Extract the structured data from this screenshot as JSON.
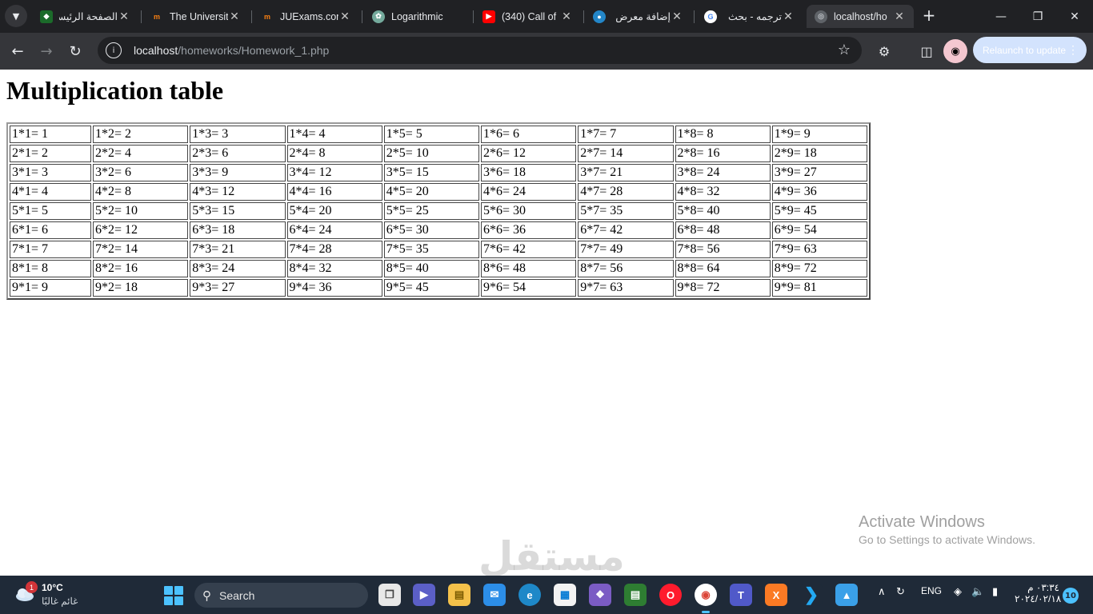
{
  "browser": {
    "tabs": [
      {
        "title": "الصفحة الرئيسية",
        "icon": "ju-logo-icon",
        "active": false
      },
      {
        "title": "The University",
        "icon": "moodle-icon",
        "active": false
      },
      {
        "title": "JUExams.com",
        "icon": "moodle-icon",
        "active": false
      },
      {
        "title": "Logarithmic",
        "icon": "chatgpt-icon",
        "active": false
      },
      {
        "title": "(340) Call of",
        "icon": "youtube-icon",
        "active": false
      },
      {
        "title": "إضافة معرض",
        "icon": "mostaql-icon",
        "active": false
      },
      {
        "title": "ترجمه - بحث",
        "icon": "google-icon",
        "active": false
      },
      {
        "title": "localhost/ho",
        "icon": "globe-icon",
        "active": true
      }
    ],
    "url_host": "localhost",
    "url_path": "/homeworks/Homework_1.php",
    "relaunch_label": "Relaunch to update"
  },
  "page": {
    "title": "Multiplication table",
    "rows": [
      [
        "1*1= 1",
        "1*2= 2",
        "1*3= 3",
        "1*4= 4",
        "1*5= 5",
        "1*6= 6",
        "1*7= 7",
        "1*8= 8",
        "1*9= 9"
      ],
      [
        "2*1= 2",
        "2*2= 4",
        "2*3= 6",
        "2*4= 8",
        "2*5= 10",
        "2*6= 12",
        "2*7= 14",
        "2*8= 16",
        "2*9= 18"
      ],
      [
        "3*1= 3",
        "3*2= 6",
        "3*3= 9",
        "3*4= 12",
        "3*5= 15",
        "3*6= 18",
        "3*7= 21",
        "3*8= 24",
        "3*9= 27"
      ],
      [
        "4*1= 4",
        "4*2= 8",
        "4*3= 12",
        "4*4= 16",
        "4*5= 20",
        "4*6= 24",
        "4*7= 28",
        "4*8= 32",
        "4*9= 36"
      ],
      [
        "5*1= 5",
        "5*2= 10",
        "5*3= 15",
        "5*4= 20",
        "5*5= 25",
        "5*6= 30",
        "5*7= 35",
        "5*8= 40",
        "5*9= 45"
      ],
      [
        "6*1= 6",
        "6*2= 12",
        "6*3= 18",
        "6*4= 24",
        "6*5= 30",
        "6*6= 36",
        "6*7= 42",
        "6*8= 48",
        "6*9= 54"
      ],
      [
        "7*1= 7",
        "7*2= 14",
        "7*3= 21",
        "7*4= 28",
        "7*5= 35",
        "7*6= 42",
        "7*7= 49",
        "7*8= 56",
        "7*9= 63"
      ],
      [
        "8*1= 8",
        "8*2= 16",
        "8*3= 24",
        "8*4= 32",
        "8*5= 40",
        "8*6= 48",
        "8*7= 56",
        "8*8= 64",
        "8*9= 72"
      ],
      [
        "9*1= 9",
        "9*2= 18",
        "9*3= 27",
        "9*4= 36",
        "9*5= 45",
        "9*6= 54",
        "9*7= 63",
        "9*8= 72",
        "9*9= 81"
      ]
    ]
  },
  "overlay": {
    "activate_title": "Activate Windows",
    "activate_sub": "Go to Settings to activate Windows.",
    "brand_mark": "مستقل"
  },
  "taskbar": {
    "weather_temp": "10°C",
    "weather_desc": "غائم غالبًا",
    "weather_badge": "1",
    "search_label": "Search",
    "lang": "ENG",
    "time": "٠٣:٣٤ م",
    "date": "٢٠٢٤/٠٢/١٨",
    "notification_count": "10"
  },
  "colors": {
    "chrome_dark": "#202124",
    "toolbar": "#35363a",
    "taskbar": "#1f2a38",
    "accent": "#4cc2ff"
  }
}
